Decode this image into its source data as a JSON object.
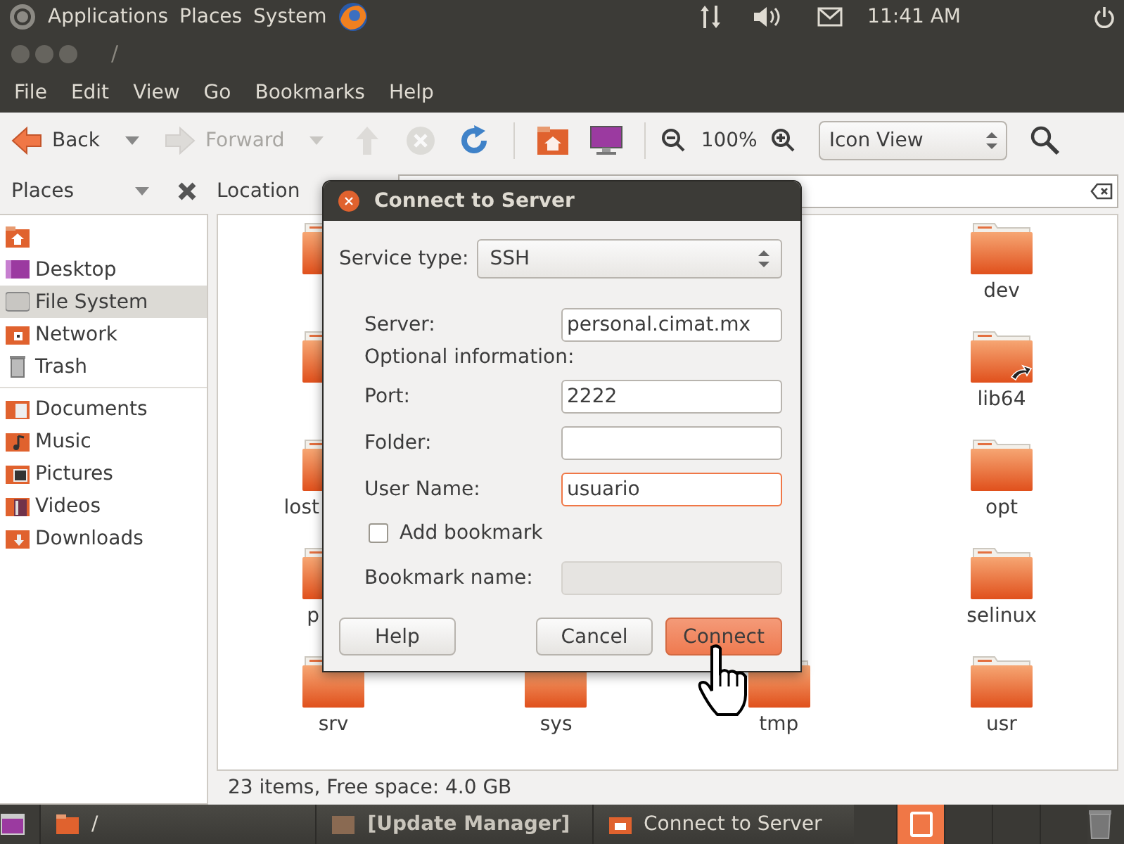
{
  "top_panel": {
    "menus": [
      "Applications",
      "Places",
      "System"
    ],
    "clock": "11:41 AM"
  },
  "window": {
    "title": "/",
    "menus": [
      "File",
      "Edit",
      "View",
      "Go",
      "Bookmarks",
      "Help"
    ]
  },
  "toolbar": {
    "buttons": [
      {
        "kind": "back",
        "label": "Back",
        "disabled": false
      },
      {
        "kind": "forward",
        "label": "Forward",
        "disabled": true
      },
      {
        "kind": "up",
        "disabled": true
      },
      {
        "kind": "stop",
        "disabled": true
      },
      {
        "kind": "reload",
        "disabled": false
      },
      {
        "kind": "home",
        "disabled": false
      },
      {
        "kind": "computer",
        "disabled": false
      }
    ],
    "zoom": "100%",
    "view_mode": "Icon View"
  },
  "sidebar": {
    "title": "Places",
    "groups": [
      [
        {
          "kind": "home",
          "selected": false
        },
        {
          "kind": "desktop",
          "label": "Desktop",
          "selected": false
        },
        {
          "kind": "drive",
          "label": "File System",
          "selected": true
        },
        {
          "kind": "network",
          "label": "Network",
          "selected": false
        },
        {
          "kind": "trash",
          "label": "Trash",
          "selected": false
        }
      ],
      [
        {
          "kind": "documents",
          "label": "Documents",
          "selected": false
        },
        {
          "kind": "music",
          "label": "Music",
          "selected": false
        },
        {
          "kind": "pictures",
          "label": "Pictures",
          "selected": false
        },
        {
          "kind": "videos",
          "label": "Videos",
          "selected": false
        },
        {
          "kind": "downloads",
          "label": "Downloads",
          "selected": false
        }
      ]
    ]
  },
  "location": {
    "label": "Location"
  },
  "files": {
    "rows": [
      {
        "items": [
          {
            "kind": "folder"
          },
          {
            "kind": "folder",
            "label": "dev"
          }
        ]
      },
      {
        "items": [
          {
            "kind": "folder"
          },
          {
            "kind": "link",
            "label": "lib64"
          }
        ]
      },
      {
        "items": [
          {
            "kind": "folder",
            "label": "lost",
            "clipped": true
          },
          {
            "kind": "folder",
            "label": "opt"
          }
        ]
      },
      {
        "items": [
          {
            "kind": "folder",
            "label": "p",
            "clipped": true
          },
          {
            "kind": "folder",
            "label": "selinux"
          }
        ]
      },
      {
        "items": [
          {
            "kind": "folder",
            "label": "srv"
          },
          {
            "kind": "folder",
            "label": "sys"
          },
          {
            "kind": "folder",
            "label": "tmp"
          },
          {
            "kind": "folder",
            "label": "usr"
          }
        ]
      }
    ]
  },
  "status_bar": "23 items, Free space: 4.0 GB",
  "dialog": {
    "title": "Connect to Server",
    "service_type_label": "Service type:",
    "service_type": "SSH",
    "rows": [
      {
        "kind": "field",
        "label": "Server:",
        "value": "personal.cimat.mx",
        "focused": false
      },
      {
        "kind": "heading",
        "label": "Optional information:"
      },
      {
        "kind": "field",
        "label": "Port:",
        "value": "2222",
        "focused": false
      },
      {
        "kind": "field",
        "label": "Folder:",
        "focused": false
      },
      {
        "kind": "field",
        "label": "User Name:",
        "value": "usuario",
        "focused": true
      },
      {
        "kind": "checkbox",
        "label": "Add bookmark",
        "checked": false
      },
      {
        "kind": "field",
        "label": "Bookmark name:",
        "disabled": true,
        "focused": false
      }
    ],
    "buttons": [
      {
        "kind": "help",
        "label": "Help",
        "default": false
      },
      {
        "kind": "cancel",
        "label": "Cancel",
        "default": false
      },
      {
        "kind": "ok",
        "label": "Connect",
        "default": true
      }
    ]
  },
  "taskbar": {
    "tasks": [
      {
        "kind": "folder",
        "label": "/",
        "minimized": false
      },
      {
        "kind": "app",
        "label": "[Update Manager]",
        "minimized": true
      },
      {
        "kind": "server",
        "label": "Connect to Server",
        "minimized": false
      }
    ],
    "workspaces": [
      {
        "selected": true
      },
      {
        "selected": false
      },
      {
        "selected": false
      },
      {
        "selected": false
      }
    ]
  }
}
